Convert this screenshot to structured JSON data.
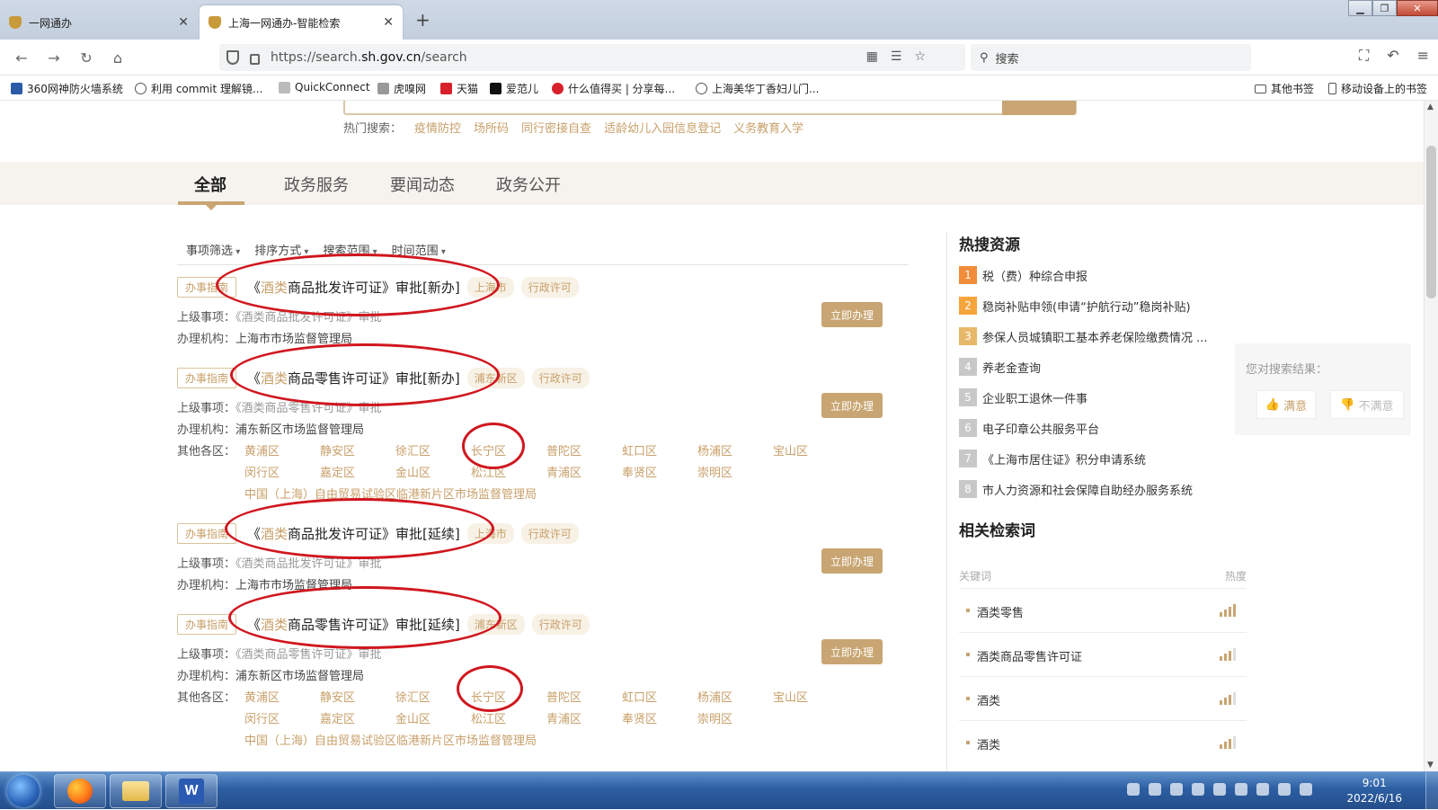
{
  "browser": {
    "tabs": [
      {
        "title": "一网通办"
      },
      {
        "title": "上海一网通办-智能检索"
      }
    ],
    "url_prefix": "https://search.",
    "url_domain": "sh.gov.cn",
    "url_path": "/search",
    "search_placeholder": "搜索",
    "bookmarks": [
      {
        "label": "360网神防火墙系统"
      },
      {
        "label": "利用 commit 理解镜..."
      },
      {
        "label": "QuickConnect"
      },
      {
        "label": "虎嗅网"
      },
      {
        "label": "天猫"
      },
      {
        "label": "爱范儿"
      },
      {
        "label": "什么值得买 | 分享每..."
      },
      {
        "label": "上海美华丁香妇儿门..."
      }
    ],
    "other_bookmarks": "其他书签",
    "mobile_bookmarks": "移动设备上的书签"
  },
  "search": {
    "hot_label": "热门搜索：",
    "hot_keywords": [
      "疫情防控",
      "场所码",
      "同行密接自查",
      "适龄幼儿入园信息登记",
      "义务教育入学"
    ]
  },
  "tabs": [
    "全部",
    "政务服务",
    "要闻动态",
    "政务公开"
  ],
  "filters": [
    "事项筛选",
    "排序方式",
    "搜索范围",
    "时间范围"
  ],
  "results": [
    {
      "badge": "办事指南",
      "title_open": "《",
      "title_hl": "酒类",
      "title_rest": "商品批发许可证》审批[新办]",
      "tags": [
        "上海市",
        "行政许可"
      ],
      "parent_label": "上级事项：",
      "parent": "《酒类商品批发许可证》审批",
      "org_label": "办理机构：",
      "org": "上海市市场监督管理局",
      "button": "立即办理"
    },
    {
      "badge": "办事指南",
      "title_open": "《",
      "title_hl": "酒类",
      "title_rest": "商品零售许可证》审批[新办]",
      "tags": [
        "浦东新区",
        "行政许可"
      ],
      "parent_label": "上级事项：",
      "parent": "《酒类商品零售许可证》审批",
      "org_label": "办理机构：",
      "org": "浦东新区市场监督管理局",
      "button": "立即办理",
      "other_label": "其他各区：",
      "districts_row1": [
        "黄浦区",
        "静安区",
        "徐汇区",
        "长宁区",
        "普陀区",
        "虹口区",
        "杨浦区",
        "宝山区"
      ],
      "districts_row2": [
        "闵行区",
        "嘉定区",
        "金山区",
        "松江区",
        "青浦区",
        "奉贤区",
        "崇明区"
      ],
      "district_long": "中国（上海）自由贸易试验区临港新片区市场监督管理局"
    },
    {
      "badge": "办事指南",
      "title_open": "《",
      "title_hl": "酒类",
      "title_rest": "商品批发许可证》审批[延续]",
      "tags": [
        "上海市",
        "行政许可"
      ],
      "parent_label": "上级事项：",
      "parent": "《酒类商品批发许可证》审批",
      "org_label": "办理机构：",
      "org": "上海市市场监督管理局",
      "button": "立即办理"
    },
    {
      "badge": "办事指南",
      "title_open": "《",
      "title_hl": "酒类",
      "title_rest": "商品零售许可证》审批[延续]",
      "tags": [
        "浦东新区",
        "行政许可"
      ],
      "parent_label": "上级事项：",
      "parent": "《酒类商品零售许可证》审批",
      "org_label": "办理机构：",
      "org": "浦东新区市场监督管理局",
      "button": "立即办理",
      "other_label": "其他各区：",
      "districts_row1": [
        "黄浦区",
        "静安区",
        "徐汇区",
        "长宁区",
        "普陀区",
        "虹口区",
        "杨浦区",
        "宝山区"
      ],
      "districts_row2": [
        "闵行区",
        "嘉定区",
        "金山区",
        "松江区",
        "青浦区",
        "奉贤区",
        "崇明区"
      ],
      "district_long": "中国（上海）自由贸易试验区临港新片区市场监督管理局"
    }
  ],
  "hot_resources": {
    "title": "热搜资源",
    "items": [
      {
        "rank": "1",
        "label": "税（费）种综合申报",
        "color": "#f08c3a"
      },
      {
        "rank": "2",
        "label": "稳岗补贴申领(申请“护航行动”稳岗补贴)",
        "color": "#f5a53c"
      },
      {
        "rank": "3",
        "label": "参保人员城镇职工基本养老保险缴费情况 ...",
        "color": "#e8b86a"
      },
      {
        "rank": "4",
        "label": "养老金查询",
        "color": "#c8c8c8"
      },
      {
        "rank": "5",
        "label": "企业职工退休一件事",
        "color": "#c8c8c8"
      },
      {
        "rank": "6",
        "label": "电子印章公共服务平台",
        "color": "#c8c8c8"
      },
      {
        "rank": "7",
        "label": "《上海市居住证》积分申请系统",
        "color": "#c8c8c8"
      },
      {
        "rank": "8",
        "label": "市人力资源和社会保障自助经办服务系统",
        "color": "#c8c8c8"
      }
    ]
  },
  "related": {
    "title": "相关检索词",
    "col_keyword": "关键词",
    "col_heat": "热度",
    "items": [
      "酒类零售",
      "酒类商品零售许可证",
      "酒类",
      "酒类"
    ]
  },
  "feedback": {
    "question": "您对搜索结果：",
    "satisfied": "满意",
    "unsatisfied": "不满意"
  },
  "taskbar": {
    "time": "9:01",
    "date": "2022/6/16"
  },
  "colors": {
    "accent": "#c8a572",
    "highlight": "#c8a06a",
    "annotation_red": "#d0171f"
  }
}
